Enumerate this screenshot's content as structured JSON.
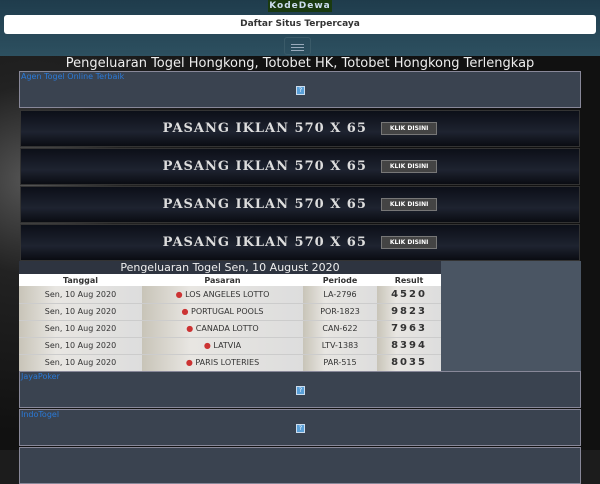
{
  "header": {
    "logo": "KodeDewa",
    "nav_label": "Daftar Situs Terpercaya"
  },
  "page_title": "Pengeluaran Togel Hongkong, Totobet HK, Totobet Hongkong Terlengkap",
  "ads": [
    {
      "label": "Agen Togel Online Terbaik"
    },
    {
      "label": "JayaPoker"
    },
    {
      "label": "IndoTogel"
    }
  ],
  "banners": [
    {
      "text": "PASANG IKLAN 570 X 65",
      "button": "KLIK DISINI"
    },
    {
      "text": "PASANG IKLAN 570 X 65",
      "button": "KLIK DISINI"
    },
    {
      "text": "PASANG IKLAN 570 X 65",
      "button": "KLIK DISINI"
    },
    {
      "text": "PASANG IKLAN 570 X 65",
      "button": "KLIK DISINI"
    }
  ],
  "results": {
    "title": "Pengeluaran Togel Sen, 10 August 2020",
    "columns": [
      "Tanggal",
      "Pasaran",
      "Periode",
      "Result"
    ],
    "rows": [
      {
        "tanggal": "Sen, 10 Aug 2020",
        "pasaran": "LOS ANGELES LOTTO",
        "periode": "LA-2796",
        "result": "4520"
      },
      {
        "tanggal": "Sen, 10 Aug 2020",
        "pasaran": "PORTUGAL POOLS",
        "periode": "POR-1823",
        "result": "9823"
      },
      {
        "tanggal": "Sen, 10 Aug 2020",
        "pasaran": "CANADA LOTTO",
        "periode": "CAN-622",
        "result": "7963"
      },
      {
        "tanggal": "Sen, 10 Aug 2020",
        "pasaran": "LATVIA",
        "periode": "LTV-1383",
        "result": "8394"
      },
      {
        "tanggal": "Sen, 10 Aug 2020",
        "pasaran": "PARIS LOTERIES",
        "periode": "PAR-515",
        "result": "8035"
      }
    ]
  }
}
